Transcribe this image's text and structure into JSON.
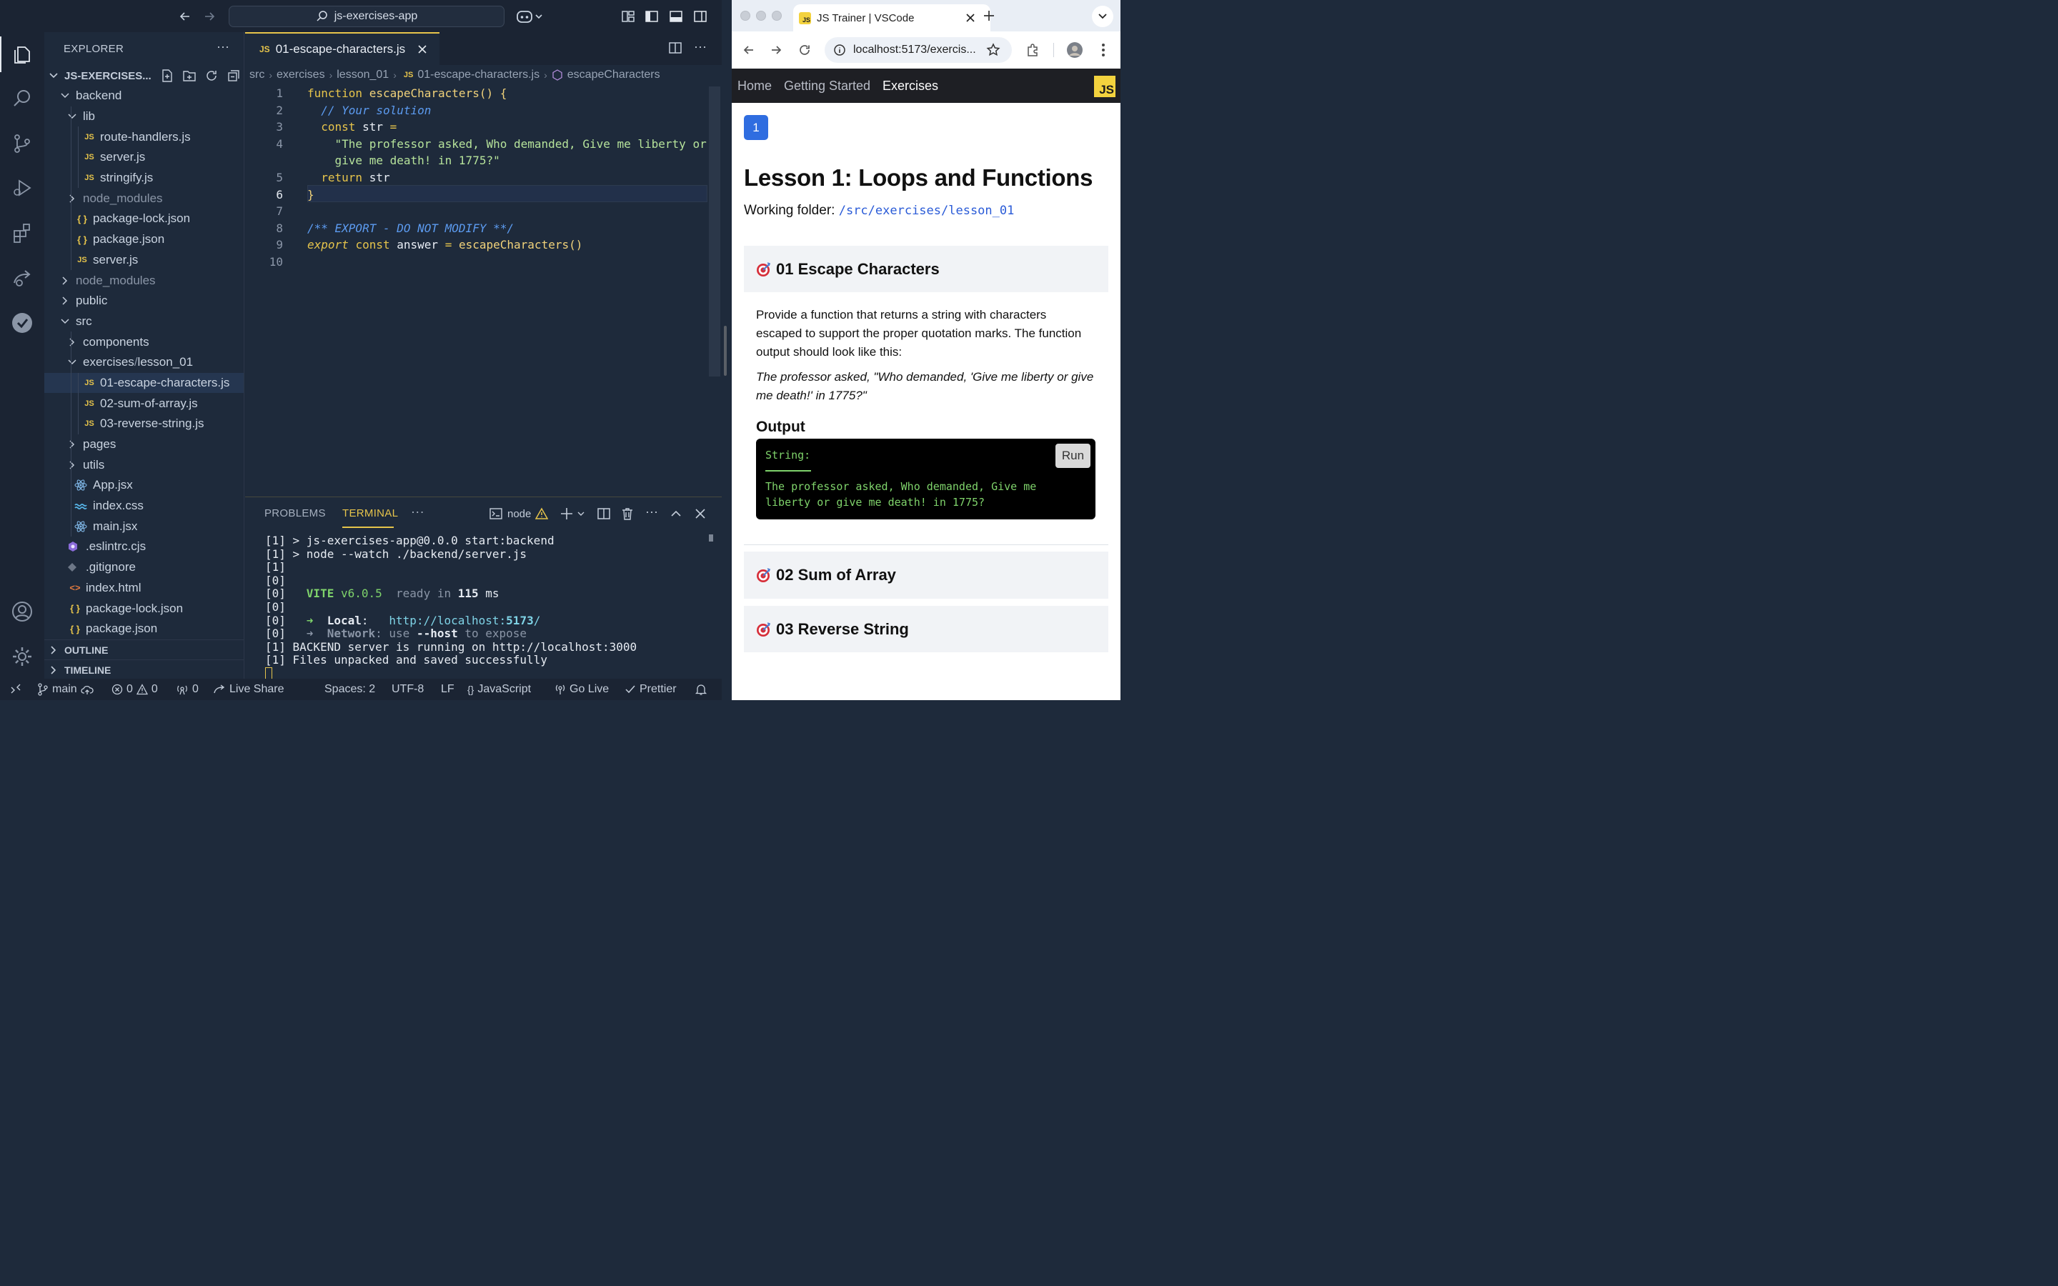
{
  "vscode": {
    "search_text": "js-exercises-app",
    "explorer_title": "EXPLORER",
    "folder_name": "JS-EXERCISES...",
    "tree": [
      {
        "label": "backend",
        "depth": 1,
        "kind": "folder-open"
      },
      {
        "label": "lib",
        "depth": 2,
        "kind": "folder-open"
      },
      {
        "label": "route-handlers.js",
        "depth": 3,
        "kind": "js"
      },
      {
        "label": "server.js",
        "depth": 3,
        "kind": "js"
      },
      {
        "label": "stringify.js",
        "depth": 3,
        "kind": "js"
      },
      {
        "label": "node_modules",
        "depth": 2,
        "kind": "folder-closed-dim"
      },
      {
        "label": "package-lock.json",
        "depth": 2,
        "kind": "json"
      },
      {
        "label": "package.json",
        "depth": 2,
        "kind": "json"
      },
      {
        "label": "server.js",
        "depth": 2,
        "kind": "js"
      },
      {
        "label": "node_modules",
        "depth": 1,
        "kind": "folder-closed-dim"
      },
      {
        "label": "public",
        "depth": 1,
        "kind": "folder-closed"
      },
      {
        "label": "src",
        "depth": 1,
        "kind": "folder-open"
      },
      {
        "label": "components",
        "depth": 2,
        "kind": "folder-closed"
      },
      {
        "label": "exercises",
        "label2": "lesson_01",
        "depth": 2,
        "kind": "folder-open-compact"
      },
      {
        "label": "01-escape-characters.js",
        "depth": 3,
        "kind": "js",
        "selected": true
      },
      {
        "label": "02-sum-of-array.js",
        "depth": 3,
        "kind": "js"
      },
      {
        "label": "03-reverse-string.js",
        "depth": 3,
        "kind": "js"
      },
      {
        "label": "pages",
        "depth": 2,
        "kind": "folder-closed"
      },
      {
        "label": "utils",
        "depth": 2,
        "kind": "folder-closed"
      },
      {
        "label": "App.jsx",
        "depth": 2,
        "kind": "react"
      },
      {
        "label": "index.css",
        "depth": 2,
        "kind": "css"
      },
      {
        "label": "main.jsx",
        "depth": 2,
        "kind": "react"
      },
      {
        "label": ".eslintrc.cjs",
        "depth": 1,
        "kind": "eslint"
      },
      {
        "label": ".gitignore",
        "depth": 1,
        "kind": "git"
      },
      {
        "label": "index.html",
        "depth": 1,
        "kind": "html"
      },
      {
        "label": "package-lock.json",
        "depth": 1,
        "kind": "json"
      },
      {
        "label": "package.json",
        "depth": 1,
        "kind": "json"
      }
    ],
    "outline_label": "OUTLINE",
    "timeline_label": "TIMELINE",
    "tab_label": "01-escape-characters.js",
    "tab_js_badge": "JS",
    "breadcrumb": [
      "src",
      "exercises",
      "lesson_01",
      "01-escape-characters.js",
      "escapeCharacters"
    ],
    "code_lines": [
      {
        "n": "1",
        "html": "<span class='kw'>function</span> <span class='fn'>escapeCharacters</span><span class='br'>()</span> <span class='br'>{</span>"
      },
      {
        "n": "2",
        "html": "  <span class='cm'>// Your solution</span>"
      },
      {
        "n": "3",
        "html": "  <span class='kw'>const</span> <span class='id'>str</span> <span class='op'>=</span>"
      },
      {
        "n": "4",
        "html": "    <span class='str'>\"The professor asked, Who demanded, Give me liberty or</span>"
      },
      {
        "n": "",
        "html": "    <span class='str'>give me death! in 1775?\"</span>"
      },
      {
        "n": "5",
        "html": "  <span class='kw'>return</span> <span class='id'>str</span>"
      },
      {
        "n": "6",
        "html": "<span class='br'>}</span>"
      },
      {
        "n": "7",
        "html": ""
      },
      {
        "n": "8",
        "html": "<span class='cm'>/** EXPORT - DO NOT MODIFY **/</span>"
      },
      {
        "n": "9",
        "html": "<span class='kw' style='font-style:italic'>export</span> <span class='kw'>const</span> <span class='id'>answer</span> <span class='op'>=</span> <span class='fn'>escapeCharacters</span><span class='br'>()</span>"
      },
      {
        "n": "10",
        "html": ""
      }
    ],
    "panel": {
      "problems_label": "PROBLEMS",
      "terminal_label": "TERMINAL",
      "more_label": "···",
      "node_label": "node"
    },
    "terminal_lines": [
      "[1] > js-exercises-app@0.0.0 start:backend",
      "[1] > node --watch ./backend/server.js",
      "[1]",
      "[0]",
      "[0]   <span class='t-green'>VITE</span> <span class='t-green' style='font-weight:normal'>v6.0.5</span>  <span class='t-dim'>ready in</span> <span class='t-bold'>115</span> ms",
      "[0]",
      "[0]   <span class='t-green'>➜</span>  <span class='t-bold'>Local</span>:   <span class='t-cyan'>http://localhost:<b>5173</b>/</span>",
      "[0]   <span class='t-dim'>➜  <b>Network</b>: use <span style='color:#e6ebf2;font-weight:bold'>--host</span> to expose</span>",
      "[1] BACKEND server is running on http://localhost:3000",
      "[1] Files unpacked and saved successfully"
    ],
    "status": {
      "branch": "main",
      "errors": "0",
      "warnings": "0",
      "ports": "0",
      "live_share": "Live Share",
      "spaces": "Spaces: 2",
      "encoding": "UTF-8",
      "eol": "LF",
      "language": "JavaScript",
      "go_live": "Go Live",
      "prettier": "Prettier"
    }
  },
  "browser": {
    "tab_title": "JS Trainer | VSCode",
    "favicon_text": "JS",
    "url": "localhost:5173/exercis...",
    "nav": [
      "Home",
      "Getting Started",
      "Exercises"
    ],
    "logo_text": "JS",
    "lesson_badge": "1",
    "lesson_title": "Lesson 1: Loops and Functions",
    "working_folder_label": "Working folder:",
    "working_folder_path": "/src/exercises/lesson_01",
    "exercises": [
      {
        "title": "01 Escape Characters"
      },
      {
        "title": "02 Sum of Array"
      },
      {
        "title": "03 Reverse String"
      }
    ],
    "description": "Provide a function that returns a string with characters escaped to support the proper quotation marks. The function output should look like this:",
    "quote": "The professor asked, \"Who demanded, 'Give me liberty or give me death!' in 1775?\"",
    "output_label": "Output",
    "output_type": "String:",
    "output_text": "The professor asked, Who demanded, Give me liberty or give me death! in 1775?",
    "run_label": "Run"
  },
  "colors": {
    "accent_yellow": "#e6c44b",
    "editor_bg": "#1e2a3b",
    "terminal_green": "#7fd36b",
    "badge_blue": "#2f6de0"
  }
}
